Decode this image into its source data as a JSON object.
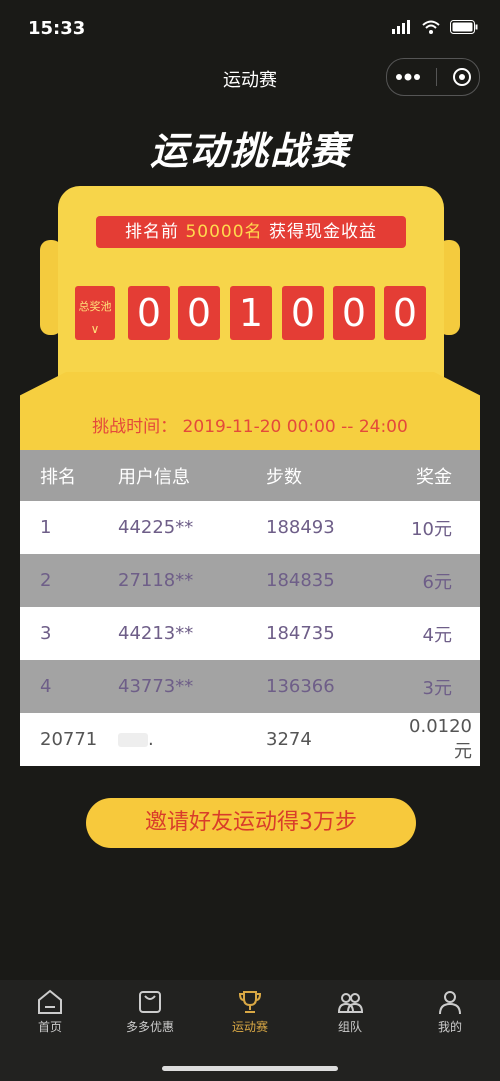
{
  "status_bar": {
    "time": "15:33"
  },
  "nav": {
    "title": "运动赛"
  },
  "title": "运动挑战赛",
  "banner": {
    "prefix": "排名前 ",
    "highlight": "50000名",
    "suffix": " 获得现金收益"
  },
  "pool": {
    "label": "总奖池",
    "arrow": "∨"
  },
  "digits": [
    "0",
    "0",
    "1",
    "0",
    "0",
    "0"
  ],
  "challenge_time": "挑战时间： 2019-11-20 00:00 -- 24:00",
  "table": {
    "headers": [
      "排名",
      "用户信息",
      "步数",
      "奖金"
    ],
    "rows": [
      {
        "rank": "1",
        "user": "44225**",
        "steps": "188493",
        "prize": "10元"
      },
      {
        "rank": "2",
        "user": "27118**",
        "steps": "184835",
        "prize": "6元"
      },
      {
        "rank": "3",
        "user": "44213**",
        "steps": "184735",
        "prize": "4元"
      },
      {
        "rank": "4",
        "user": "43773**",
        "steps": "136366",
        "prize": "3元"
      },
      {
        "rank": "20771",
        "user": ".",
        "steps": "3274",
        "prize": "0.0120元"
      }
    ]
  },
  "invite_button": "邀请好友运动得3万步",
  "tabs": [
    {
      "label": "首页",
      "icon": "home-icon"
    },
    {
      "label": "多多优惠",
      "icon": "bag-icon"
    },
    {
      "label": "运动赛",
      "icon": "trophy-icon",
      "active": true
    },
    {
      "label": "组队",
      "icon": "team-icon"
    },
    {
      "label": "我的",
      "icon": "user-icon"
    }
  ],
  "colors": {
    "accent_yellow": "#f7d54a",
    "accent_red": "#e43d35",
    "tab_active": "#d9a845"
  }
}
